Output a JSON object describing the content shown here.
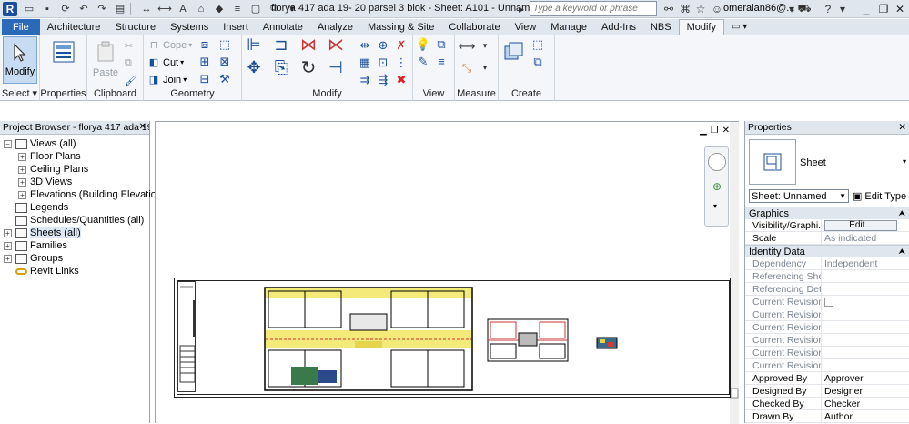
{
  "titlebar": {
    "logo": "R",
    "doc_title": "florya 417 ada 19- 20 parsel 3 blok - Sheet: A101 - Unnamed",
    "search_placeholder": "Type a keyword or phrase",
    "user": "omeralan86@..."
  },
  "tabs": [
    "File",
    "Architecture",
    "Structure",
    "Systems",
    "Insert",
    "Annotate",
    "Analyze",
    "Massing & Site",
    "Collaborate",
    "View",
    "Manage",
    "Add-Ins",
    "NBS",
    "Modify"
  ],
  "active_tab": "Modify",
  "ribbon": {
    "select": {
      "modify_label": "Modify",
      "panel_label": "Select"
    },
    "properties": {
      "label": "Properties"
    },
    "clipboard": {
      "paste": "Paste",
      "cope": "Cope",
      "cut": "Cut",
      "join": "Join",
      "panel_label": "Clipboard"
    },
    "geometry": {
      "panel_label": "Geometry"
    },
    "modify": {
      "panel_label": "Modify"
    },
    "view": {
      "panel_label": "View"
    },
    "measure": {
      "panel_label": "Measure"
    },
    "create": {
      "panel_label": "Create"
    }
  },
  "project_browser": {
    "header": "Project Browser - florya 417 ada 19...",
    "items": [
      {
        "label": "Views (all)",
        "level": 0,
        "exp": "−"
      },
      {
        "label": "Floor Plans",
        "level": 1,
        "exp": "+"
      },
      {
        "label": "Ceiling Plans",
        "level": 1,
        "exp": "+"
      },
      {
        "label": "3D Views",
        "level": 1,
        "exp": "+"
      },
      {
        "label": "Elevations (Building Elevation)",
        "level": 1,
        "exp": "+"
      },
      {
        "label": "Legends",
        "level": 0,
        "exp": ""
      },
      {
        "label": "Schedules/Quantities (all)",
        "level": 0,
        "exp": ""
      },
      {
        "label": "Sheets (all)",
        "level": 0,
        "exp": "+"
      },
      {
        "label": "Families",
        "level": 0,
        "exp": "+"
      },
      {
        "label": "Groups",
        "level": 0,
        "exp": "+"
      },
      {
        "label": "Revit Links",
        "level": 0,
        "exp": ""
      }
    ]
  },
  "properties": {
    "header": "Properties",
    "type_name": "Sheet",
    "instance_select": "Sheet: Unnamed",
    "edit_type": "Edit Type",
    "groups": [
      {
        "name": "Graphics",
        "rows": [
          {
            "name": "Visibility/Graphi...",
            "value": "Edit...",
            "kind": "button"
          },
          {
            "name": "Scale",
            "value": "As indicated",
            "kind": "ro-value"
          }
        ]
      },
      {
        "name": "Identity Data",
        "rows": [
          {
            "name": "Dependency",
            "value": "Independent",
            "kind": "ro"
          },
          {
            "name": "Referencing Sheet",
            "value": "",
            "kind": "ro"
          },
          {
            "name": "Referencing Detail",
            "value": "",
            "kind": "ro"
          },
          {
            "name": "Current Revision...",
            "value": "",
            "kind": "check"
          },
          {
            "name": "Current Revision...",
            "value": "",
            "kind": "ro"
          },
          {
            "name": "Current Revision...",
            "value": "",
            "kind": "ro"
          },
          {
            "name": "Current Revision...",
            "value": "",
            "kind": "ro"
          },
          {
            "name": "Current Revision...",
            "value": "",
            "kind": "ro"
          },
          {
            "name": "Current Revision",
            "value": "",
            "kind": "ro"
          },
          {
            "name": "Approved By",
            "value": "Approver",
            "kind": "normal"
          },
          {
            "name": "Designed By",
            "value": "Designer",
            "kind": "normal"
          },
          {
            "name": "Checked By",
            "value": "Checker",
            "kind": "normal"
          },
          {
            "name": "Drawn By",
            "value": "Author",
            "kind": "normal"
          }
        ]
      }
    ]
  }
}
